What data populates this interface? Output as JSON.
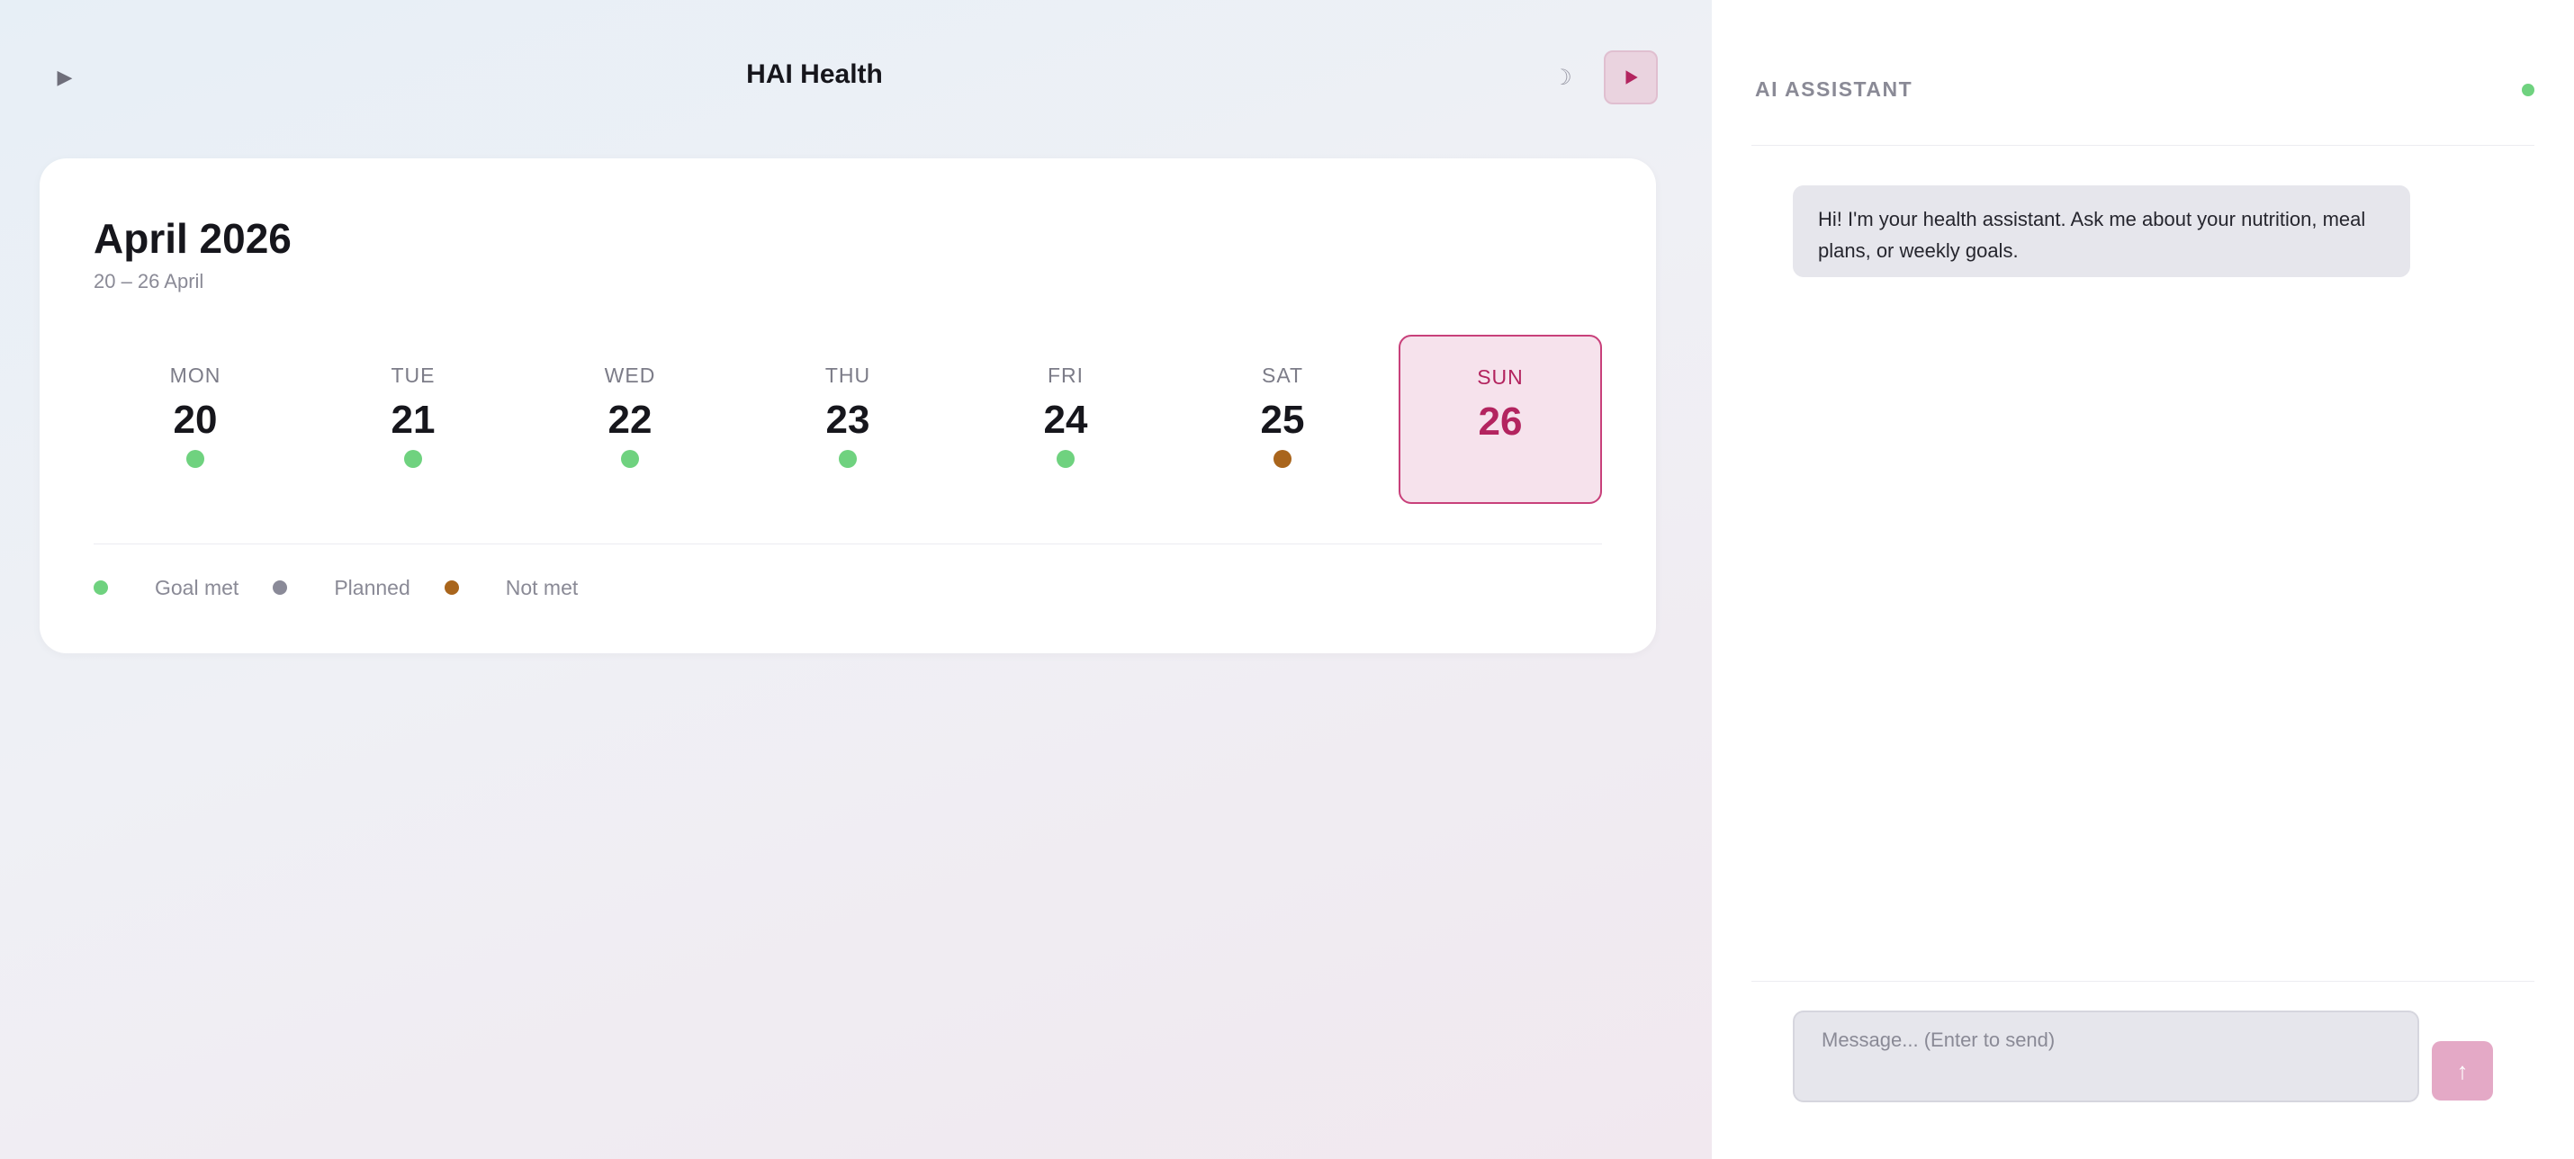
{
  "header": {
    "collapse_glyph": "▶",
    "title": "HAI Health",
    "theme_glyph": "☽"
  },
  "calendar": {
    "month_title": "April 2026",
    "range": "20 – 26 April",
    "days": [
      {
        "name": "MON",
        "num": "20",
        "status": "goal-met",
        "selected": false
      },
      {
        "name": "TUE",
        "num": "21",
        "status": "goal-met",
        "selected": false
      },
      {
        "name": "WED",
        "num": "22",
        "status": "goal-met",
        "selected": false
      },
      {
        "name": "THU",
        "num": "23",
        "status": "goal-met",
        "selected": false
      },
      {
        "name": "FRI",
        "num": "24",
        "status": "goal-met",
        "selected": false
      },
      {
        "name": "SAT",
        "num": "25",
        "status": "not-met",
        "selected": false
      },
      {
        "name": "SUN",
        "num": "26",
        "status": "none",
        "selected": true
      }
    ],
    "legend": [
      {
        "label": "Goal met",
        "color": "#6fd27f"
      },
      {
        "label": "Planned",
        "color": "#8a8a98"
      },
      {
        "label": "Not met",
        "color": "#a9651c"
      }
    ]
  },
  "colors": {
    "goal_met": "#6fd27f",
    "planned": "#8a8a98",
    "not_met": "#a9651c",
    "accent": "#b3245f",
    "online": "#6fd27f"
  },
  "assistant": {
    "title": "AI ASSISTANT",
    "messages": [
      {
        "role": "assistant",
        "text": "Hi! I'm your health assistant. Ask me about your nutrition, meal plans, or weekly goals."
      }
    ],
    "input_placeholder": "Message... (Enter to send)",
    "send_glyph": "↑"
  }
}
